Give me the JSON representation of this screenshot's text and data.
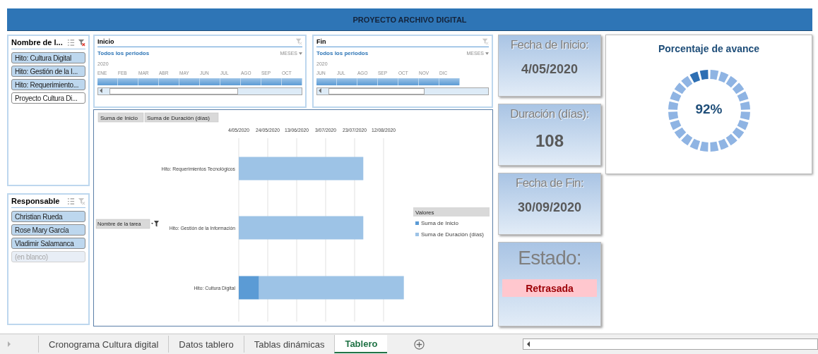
{
  "title": "PROYECTO ARCHIVO DIGITAL",
  "slicers": [
    {
      "title": "Nombre de l...",
      "filter_active": true,
      "items": [
        {
          "label": "Hito: Cultura Digital",
          "selected": true,
          "disabled": false
        },
        {
          "label": "Hito: Gestión de la I...",
          "selected": true,
          "disabled": false
        },
        {
          "label": "Hito: Requerimiento...",
          "selected": true,
          "disabled": false
        },
        {
          "label": "Proyecto Cultura Di...",
          "selected": false,
          "disabled": false
        }
      ]
    },
    {
      "title": "Responsable",
      "filter_active": false,
      "items": [
        {
          "label": "Christian Rueda",
          "selected": true,
          "disabled": false
        },
        {
          "label": "Rose Mary García",
          "selected": true,
          "disabled": false
        },
        {
          "label": "Vladimir Salamanca",
          "selected": true,
          "disabled": false
        },
        {
          "label": "(en blanco)",
          "selected": true,
          "disabled": true
        }
      ]
    }
  ],
  "timelines": [
    {
      "title": "Inicio",
      "period_label": "Todos los periodos",
      "unit": "MESES",
      "year": "2020",
      "months": [
        "ENE",
        "FEB",
        "MAR",
        "ABR",
        "MAY",
        "JUN",
        "JUL",
        "AGO",
        "SEP",
        "OCT"
      ]
    },
    {
      "title": "Fin",
      "period_label": "Todos los periodos",
      "unit": "MESES",
      "year": "2020",
      "months": [
        "JUN",
        "JUL",
        "AGO",
        "SEP",
        "OCT",
        "NOV",
        "DIC"
      ]
    }
  ],
  "chart": {
    "field_buttons": [
      "Suma de Inicio",
      "Suma de Duración (días)"
    ],
    "row_field": "Nombre de la tarea",
    "legend_title": "Valores",
    "axis_labels": [
      "4/05/2020",
      "24/05/2020",
      "13/06/2020",
      "3/07/2020",
      "23/07/2020",
      "12/08/2020"
    ],
    "categories": [
      "Hito: Requerimientos Tecnológicos",
      "Hito: Gestión de la Información",
      "Hito: Cultura Digital"
    ],
    "legend": [
      {
        "name": "Suma de Inicio",
        "color": "#5b9bd5"
      },
      {
        "name": "Suma de Duración (días)",
        "color": "#9dc3e6"
      }
    ]
  },
  "cards": [
    {
      "kind": "metric",
      "label": "Fecha de Inicio:",
      "value": "4/05/2020"
    },
    {
      "kind": "metric",
      "label": "Duración (días):",
      "value": "108"
    },
    {
      "kind": "metric",
      "label": "Fecha de Fin:",
      "value": "30/09/2020"
    },
    {
      "kind": "status",
      "label": "Estado:",
      "value": "Retrasada"
    }
  ],
  "progress": {
    "title": "Porcentaje de avance",
    "reading": "92%"
  },
  "sheet_tabs": [
    {
      "label": "Cronograma Cultura digital",
      "selected": false
    },
    {
      "label": "Datos tablero",
      "selected": false
    },
    {
      "label": "Tablas dinámicas",
      "selected": false
    },
    {
      "label": "Tablero",
      "selected": true
    }
  ]
}
